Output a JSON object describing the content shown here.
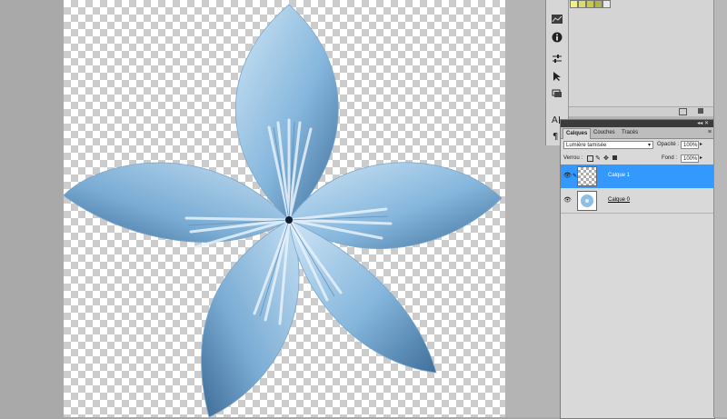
{
  "layers_panel": {
    "tabs": [
      {
        "label": "Calques",
        "active": true
      },
      {
        "label": "Couches",
        "active": false
      },
      {
        "label": "Tracés",
        "active": false
      }
    ],
    "blend_mode": "Lumière tamisée",
    "opacity_label": "Opacité :",
    "opacity_value": "100%",
    "lock_label": "Verrou :",
    "fill_label": "Fond :",
    "fill_value": "100%",
    "layers": [
      {
        "name": "Calque 1",
        "selected": true,
        "visible": true
      },
      {
        "name": "Calque 0",
        "selected": false,
        "visible": true
      }
    ]
  },
  "toolstrip": {
    "icons": [
      "histogram-icon",
      "info-icon",
      "adjustments-icon",
      "path-select-icon",
      "layer-comp-icon",
      "text-icon",
      "paragraph-icon"
    ]
  },
  "swatches": {
    "colors": [
      "#f0f08a",
      "#dcdc64",
      "#c8c850",
      "#b4b440",
      "#e8e8e8"
    ]
  },
  "colors": {
    "selection": "#3399ff",
    "flower_light": "#bcd9ef",
    "flower_dark": "#4a7aa6"
  }
}
